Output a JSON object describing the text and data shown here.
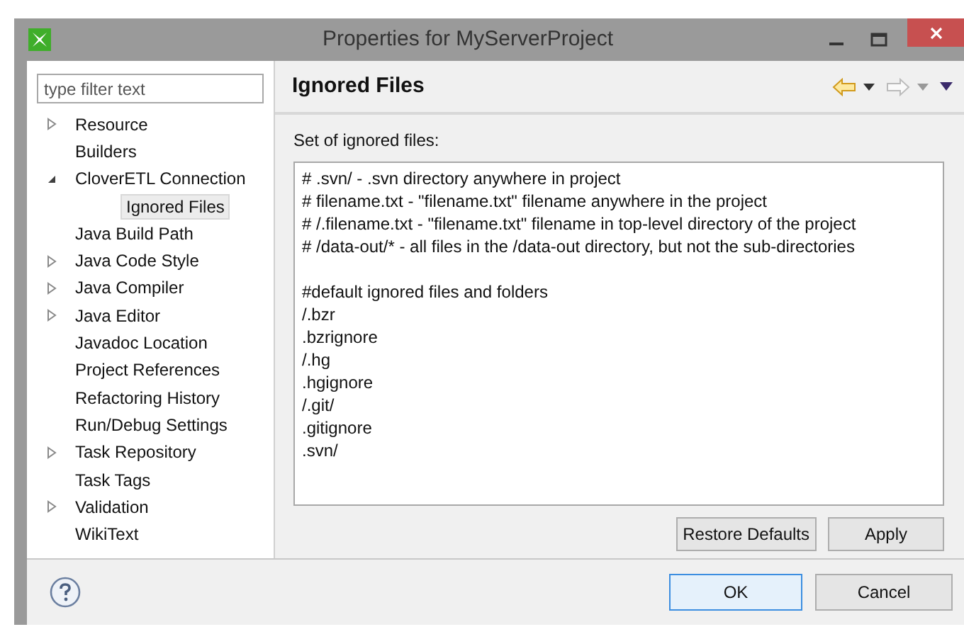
{
  "window": {
    "title": "Properties for MyServerProject"
  },
  "filter": {
    "placeholder": "type filter text"
  },
  "tree": [
    {
      "label": "Resource",
      "expandable": true,
      "expanded": false,
      "selected": false
    },
    {
      "label": "Builders",
      "expandable": false,
      "selected": false
    },
    {
      "label": "CloverETL Connection",
      "expandable": true,
      "expanded": true,
      "selected": false,
      "children": [
        {
          "label": "Ignored Files",
          "expandable": false,
          "selected": true
        }
      ]
    },
    {
      "label": "Java Build Path",
      "expandable": false,
      "selected": false
    },
    {
      "label": "Java Code Style",
      "expandable": true,
      "expanded": false,
      "selected": false
    },
    {
      "label": "Java Compiler",
      "expandable": true,
      "expanded": false,
      "selected": false
    },
    {
      "label": "Java Editor",
      "expandable": true,
      "expanded": false,
      "selected": false
    },
    {
      "label": "Javadoc Location",
      "expandable": false,
      "selected": false
    },
    {
      "label": "Project References",
      "expandable": false,
      "selected": false
    },
    {
      "label": "Refactoring History",
      "expandable": false,
      "selected": false
    },
    {
      "label": "Run/Debug Settings",
      "expandable": false,
      "selected": false
    },
    {
      "label": "Task Repository",
      "expandable": true,
      "expanded": false,
      "selected": false
    },
    {
      "label": "Task Tags",
      "expandable": false,
      "selected": false
    },
    {
      "label": "Validation",
      "expandable": true,
      "expanded": false,
      "selected": false
    },
    {
      "label": "WikiText",
      "expandable": false,
      "selected": false
    }
  ],
  "page": {
    "title": "Ignored Files",
    "field_label": "Set of ignored files:",
    "text_blocks": [
      [
        "# .svn/ - .svn directory anywhere in project",
        "# filename.txt - \"filename.txt\" filename anywhere in the project",
        "# /.filename.txt - \"filename.txt\" filename in top-level directory of the project",
        "# /data-out/* - all files in the /data-out directory, but not the sub-directories"
      ],
      [
        "#default ignored files and folders",
        "/.bzr",
        ".bzrignore",
        "/.hg",
        ".hgignore",
        "/.git/",
        ".gitignore",
        ".svn/"
      ]
    ],
    "buttons": [
      "Restore Defaults",
      "Apply"
    ]
  },
  "dialog_buttons": [
    {
      "label": "OK",
      "default": true
    },
    {
      "label": "Cancel",
      "default": false
    }
  ]
}
